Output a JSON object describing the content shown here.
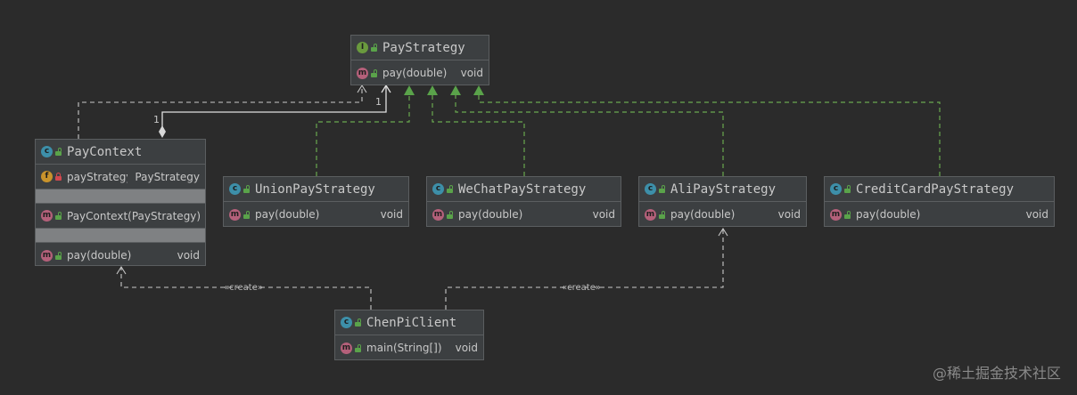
{
  "colors": {
    "background": "#2b2b2b",
    "class_icon": "#3d8fa9",
    "interface_icon": "#6a9a3e",
    "method_icon": "#b4607a",
    "field_icon": "#c9932b",
    "realization_arrow": "#5aa34a",
    "dependency_line": "#c8c8c8"
  },
  "nodes": {
    "pay_strategy": {
      "kind": "interface",
      "icon": "interface-icon",
      "name": "PayStrategy",
      "methods": [
        {
          "name": "pay(double)",
          "type": "void"
        }
      ]
    },
    "pay_context": {
      "kind": "class",
      "icon": "class-icon",
      "name": "PayContext",
      "fields": [
        {
          "name": "payStrategy",
          "type": "PayStrategy",
          "visibility": "private"
        }
      ],
      "constructors": [
        {
          "name": "PayContext(PayStrategy)",
          "type": ""
        }
      ],
      "methods": [
        {
          "name": "pay(double)",
          "type": "void"
        }
      ]
    },
    "union_pay": {
      "kind": "class",
      "icon": "class-icon",
      "name": "UnionPayStrategy",
      "methods": [
        {
          "name": "pay(double)",
          "type": "void"
        }
      ]
    },
    "wechat_pay": {
      "kind": "class",
      "icon": "class-icon",
      "name": "WeChatPayStrategy",
      "methods": [
        {
          "name": "pay(double)",
          "type": "void"
        }
      ]
    },
    "ali_pay": {
      "kind": "class",
      "icon": "class-icon",
      "name": "AliPayStrategy",
      "methods": [
        {
          "name": "pay(double)",
          "type": "void"
        }
      ]
    },
    "credit_card_pay": {
      "kind": "class",
      "icon": "class-icon",
      "name": "CreditCardPayStrategy",
      "methods": [
        {
          "name": "pay(double)",
          "type": "void"
        }
      ]
    },
    "chenpi_client": {
      "kind": "class",
      "icon": "class-icon",
      "name": "ChenPiClient",
      "methods": [
        {
          "name": "main(String[])",
          "type": "void"
        }
      ]
    }
  },
  "edges": {
    "aggregation_multiplicity_top": "1",
    "aggregation_multiplicity_bottom": "1",
    "create_label_left": "«create»",
    "create_label_right": "«create»"
  },
  "watermark": "@稀土掘金技术社区"
}
